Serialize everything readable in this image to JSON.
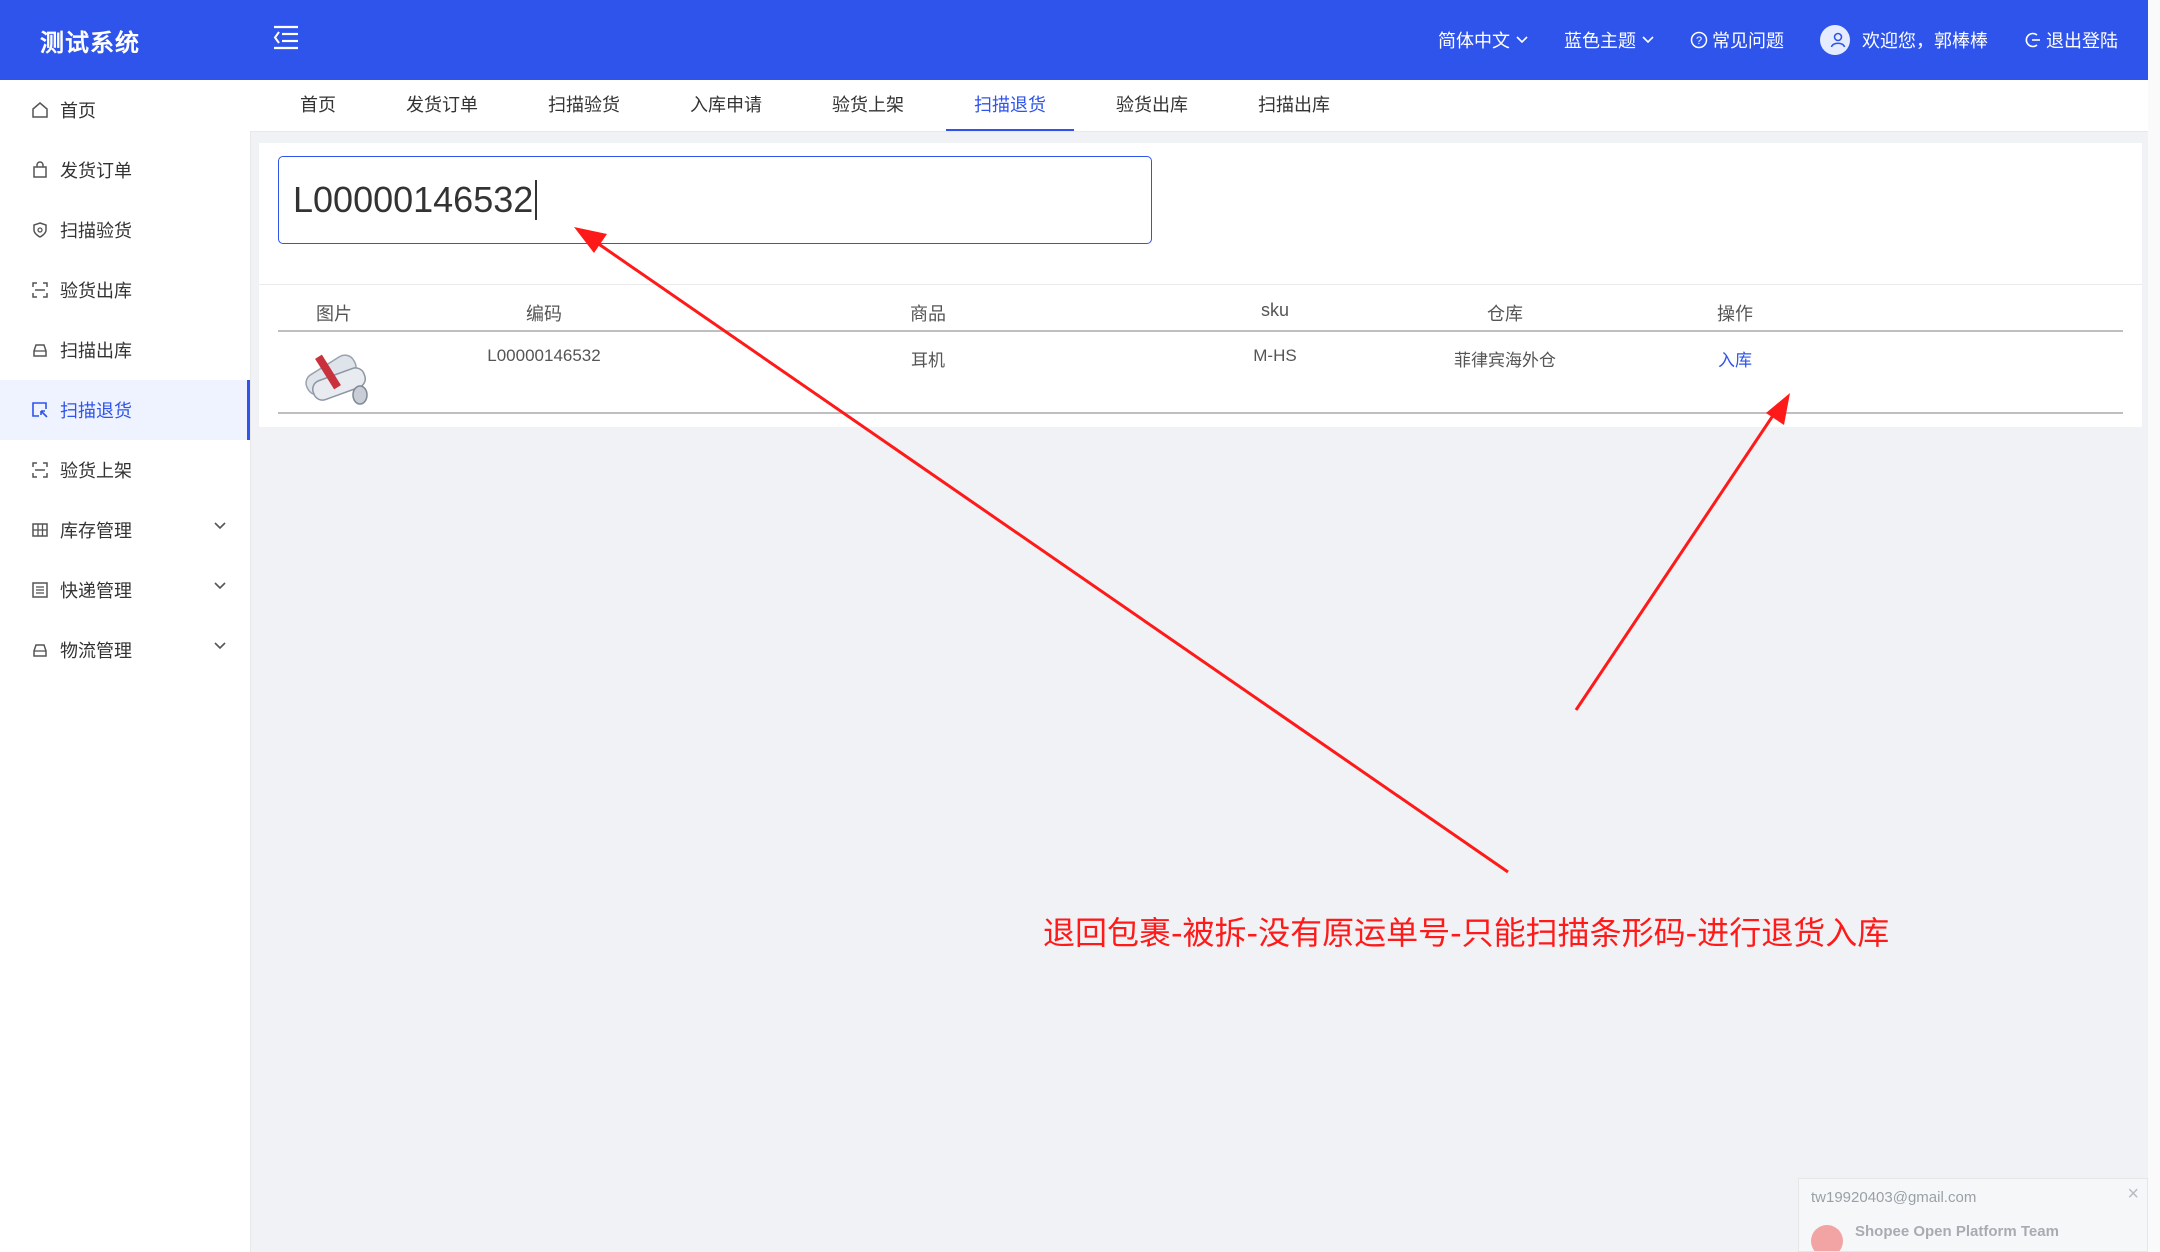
{
  "app": {
    "title": "测试系统"
  },
  "header": {
    "language": "简体中文",
    "theme": "蓝色主题",
    "faq": "常见问题",
    "welcome": "欢迎您，郭棒棒",
    "logout": "退出登陆"
  },
  "sidebar": {
    "items": [
      {
        "label": "首页",
        "icon": "home-icon"
      },
      {
        "label": "发货订单",
        "icon": "bag-icon"
      },
      {
        "label": "扫描验货",
        "icon": "shield-icon"
      },
      {
        "label": "验货出库",
        "icon": "scan-icon"
      },
      {
        "label": "扫描出库",
        "icon": "car-icon"
      },
      {
        "label": "扫描退货",
        "icon": "return-icon",
        "active": true
      },
      {
        "label": "验货上架",
        "icon": "scan-icon"
      },
      {
        "label": "库存管理",
        "icon": "grid-icon",
        "expandable": true
      },
      {
        "label": "快递管理",
        "icon": "list-icon",
        "expandable": true
      },
      {
        "label": "物流管理",
        "icon": "car-icon",
        "expandable": true
      }
    ]
  },
  "tabs": [
    {
      "label": "首页"
    },
    {
      "label": "发货订单"
    },
    {
      "label": "扫描验货"
    },
    {
      "label": "入库申请"
    },
    {
      "label": "验货上架"
    },
    {
      "label": "扫描退货",
      "active": true
    },
    {
      "label": "验货出库"
    },
    {
      "label": "扫描出库"
    }
  ],
  "scan": {
    "value": "L00000146532"
  },
  "table": {
    "columns": [
      "图片",
      "编码",
      "商品",
      "sku",
      "仓库",
      "操作"
    ],
    "rows": [
      {
        "code": "L00000146532",
        "product": "耳机",
        "sku": "M-HS",
        "warehouse": "菲律宾海外仓",
        "action": "入库"
      }
    ]
  },
  "annotation": {
    "text": "退回包裹-被拆-没有原运单号-只能扫描条形码-进行退货入库",
    "color": "#ff1a1a"
  },
  "toast": {
    "email": "tw19920403@gmail.com",
    "title": "Shopee Open Platform Team"
  },
  "colors": {
    "primary": "#2f54eb",
    "background": "#f0f2f5"
  }
}
